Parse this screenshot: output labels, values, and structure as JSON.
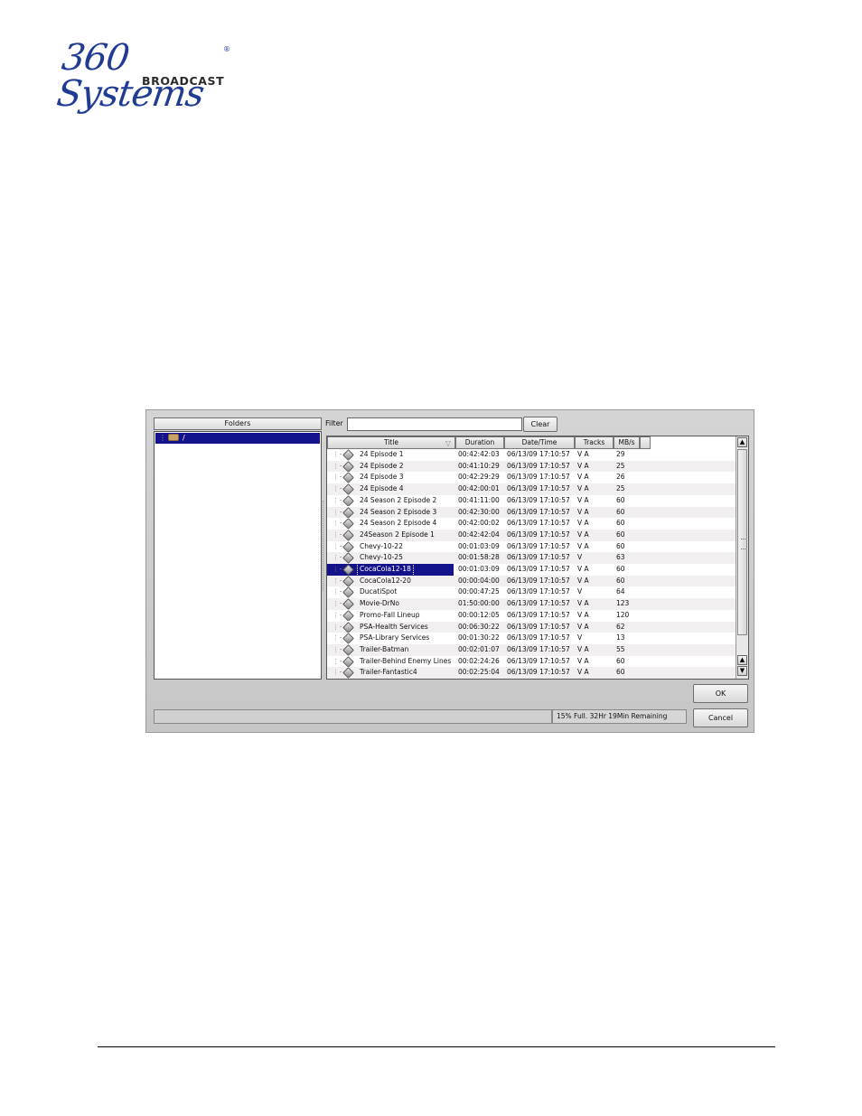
{
  "logo": {
    "script": "360 Systems",
    "sub": "BROADCAST",
    "reg_mark": "®"
  },
  "dialog": {
    "folders_header": "Folders",
    "folder_root": "/",
    "filter_label": "Filter",
    "filter_value": "",
    "clear_label": "Clear",
    "columns": {
      "title": "Title",
      "duration": "Duration",
      "datetime": "Date/Time",
      "tracks": "Tracks",
      "mbs": "MB/s"
    },
    "rows": [
      {
        "title": "24 Episode 1",
        "duration": "00:42:42:03",
        "datetime": "06/13/09 17:10:57",
        "tracks": "V A",
        "mbs": "29"
      },
      {
        "title": "24 Episode 2",
        "duration": "00:41:10:29",
        "datetime": "06/13/09 17:10:57",
        "tracks": "V A",
        "mbs": "25"
      },
      {
        "title": "24 Episode 3",
        "duration": "00:42:29:29",
        "datetime": "06/13/09 17:10:57",
        "tracks": "V A",
        "mbs": "26"
      },
      {
        "title": "24 Episode 4",
        "duration": "00:42:00:01",
        "datetime": "06/13/09 17:10:57",
        "tracks": "V A",
        "mbs": "25"
      },
      {
        "title": "24 Season 2 Episode 2",
        "duration": "00:41:11:00",
        "datetime": "06/13/09 17:10:57",
        "tracks": "V A",
        "mbs": "60"
      },
      {
        "title": "24 Season 2 Episode 3",
        "duration": "00:42:30:00",
        "datetime": "06/13/09 17:10:57",
        "tracks": "V A",
        "mbs": "60"
      },
      {
        "title": "24 Season 2 Episode 4",
        "duration": "00:42:00:02",
        "datetime": "06/13/09 17:10:57",
        "tracks": "V A",
        "mbs": "60"
      },
      {
        "title": "24Season 2 Episode 1",
        "duration": "00:42:42:04",
        "datetime": "06/13/09 17:10:57",
        "tracks": "V A",
        "mbs": "60"
      },
      {
        "title": "Chevy-10-22",
        "duration": "00:01:03:09",
        "datetime": "06/13/09 17:10:57",
        "tracks": "V A",
        "mbs": "60"
      },
      {
        "title": "Chevy-10-25",
        "duration": "00:01:58:28",
        "datetime": "06/13/09 17:10:57",
        "tracks": "V",
        "mbs": "63"
      },
      {
        "title": "CocaCola12-18",
        "duration": "00:01:03:09",
        "datetime": "06/13/09 17:10:57",
        "tracks": "V A",
        "mbs": "60"
      },
      {
        "title": "CocaCola12-20",
        "duration": "00:00:04:00",
        "datetime": "06/13/09 17:10:57",
        "tracks": "V A",
        "mbs": "60"
      },
      {
        "title": "DucatiSpot",
        "duration": "00:00:47:25",
        "datetime": "06/13/09 17:10:57",
        "tracks": "V",
        "mbs": "64"
      },
      {
        "title": "Movie-DrNo",
        "duration": "01:50:00:00",
        "datetime": "06/13/09 17:10:57",
        "tracks": "V A",
        "mbs": "123"
      },
      {
        "title": "Promo-Fall Lineup",
        "duration": "00:00:12:05",
        "datetime": "06/13/09 17:10:57",
        "tracks": "V A",
        "mbs": "120"
      },
      {
        "title": "PSA-Health Services",
        "duration": "00:06:30:22",
        "datetime": "06/13/09 17:10:57",
        "tracks": "V A",
        "mbs": "62"
      },
      {
        "title": "PSA-Library Services",
        "duration": "00:01:30:22",
        "datetime": "06/13/09 17:10:57",
        "tracks": "V",
        "mbs": "13"
      },
      {
        "title": "Trailer-Batman",
        "duration": "00:02:01:07",
        "datetime": "06/13/09 17:10:57",
        "tracks": "V A",
        "mbs": "55"
      },
      {
        "title": "Trailer-Behind Enemy Lines",
        "duration": "00:02:24:26",
        "datetime": "06/13/09 17:10:57",
        "tracks": "V A",
        "mbs": "60"
      },
      {
        "title": "Trailer-Fantastic4",
        "duration": "00:02:25:04",
        "datetime": "06/13/09 17:10:57",
        "tracks": "V A",
        "mbs": "60"
      }
    ],
    "selected_index": 10,
    "ok_label": "OK",
    "cancel_label": "Cancel",
    "status": "15% Full. 32Hr 19Min Remaining"
  }
}
